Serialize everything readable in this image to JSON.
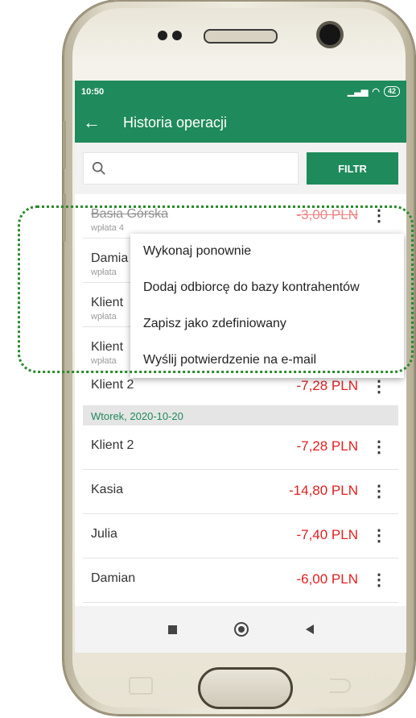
{
  "status_bar": {
    "time": "10:50",
    "battery": "42"
  },
  "app_bar": {
    "title": "Historia operacji"
  },
  "search": {
    "placeholder": "",
    "filter_label": "FILTR"
  },
  "top_rows": [
    {
      "name": "Basia Górska",
      "sub": "wpłata 4",
      "amount": "-3,00 PLN"
    },
    {
      "name": "Damia",
      "sub": "wpłata"
    },
    {
      "name": "Klient",
      "sub": "wpłata"
    },
    {
      "name": "Klient",
      "sub": "wpłata"
    },
    {
      "name": "Klient 2",
      "amount": "-7,28 PLN"
    }
  ],
  "date_group": "Wtorek, 2020-10-20",
  "rows": [
    {
      "name": "Klient 2",
      "amount": "-7,28 PLN"
    },
    {
      "name": "Kasia",
      "amount": "-14,80 PLN"
    },
    {
      "name": "Julia",
      "amount": "-7,40 PLN"
    },
    {
      "name": "Damian",
      "amount": "-6,00 PLN"
    }
  ],
  "context_menu": [
    "Wykonaj ponownie",
    "Dodaj odbiorcę do bazy kontrahentów",
    "Zapisz jako zdefiniowany",
    "Wyślij potwierdzenie na e-mail"
  ],
  "colors": {
    "primary": "#1f8a5b",
    "negative_amount": "#e02020",
    "highlight_border": "#2a8a2a"
  }
}
